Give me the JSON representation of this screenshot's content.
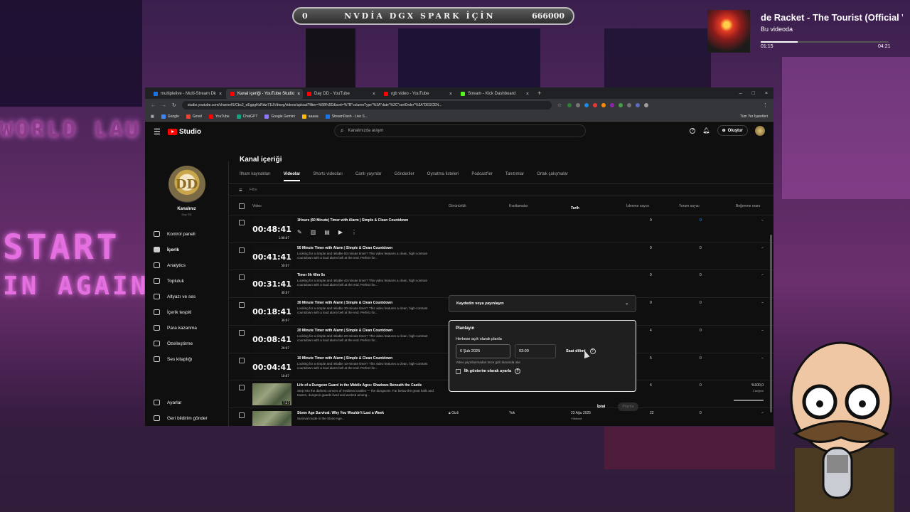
{
  "stream": {
    "goal_left": "0",
    "goal_text": "NVDİA DGX SPARK İÇİN",
    "goal_right": "666000",
    "now_playing_title": "de Racket - The Tourist (Official Vi",
    "now_playing_sub": "Bu videoda",
    "time_elapsed": "01:15",
    "time_total": "04:21",
    "progress": 0.29,
    "neon_sign_1": "WORLD LAU",
    "neon_sign_2": "START",
    "neon_sign_3": "IN AGAIN"
  },
  "browser": {
    "tabs": [
      {
        "label": "multiplelive - Multi-Stream Dk",
        "color": "#1a73e8"
      },
      {
        "label": "Kanal içeriği - YouTube Studio",
        "color": "#ff0000",
        "active": true
      },
      {
        "label": "Day DD - YouTube",
        "color": "#ff0000"
      },
      {
        "label": "rgb video - YouTube",
        "color": "#ff0000"
      },
      {
        "label": "Stream - Kick Dashboard",
        "color": "#53fc18"
      }
    ],
    "url": "studio.youtube.com/channel/UCbc2_eEgpgHzRdw71UVdwvg/videos/upload?filter=%5B%5D&sort=%7B\"columnType\"%3A\"date\"%2C\"sortOrder\"%3A\"DESCEN...",
    "bookmarks": [
      "Google",
      "Gmail",
      "YouTube",
      "ChatGPT",
      "Google Gemini",
      "aaaaa",
      "StreamDash - Live S..."
    ],
    "all_bookmarks": "Tüm Yer İşaretleri"
  },
  "studio": {
    "logo": "Studio",
    "search_placeholder": "Kanalınızda arayın",
    "create_label": "Oluştur",
    "channel_label": "Kanalınız",
    "channel_name": "Day DD",
    "nav": [
      {
        "label": "Kontrol paneli",
        "icon": "dashboard-icon"
      },
      {
        "label": "İçerik",
        "icon": "content-icon",
        "active": true
      },
      {
        "label": "Analytics",
        "icon": "analytics-icon"
      },
      {
        "label": "Topluluk",
        "icon": "community-icon"
      },
      {
        "label": "Altyazı ve ses",
        "icon": "subtitles-icon"
      },
      {
        "label": "İçerik tespiti",
        "icon": "copyright-icon"
      },
      {
        "label": "Para kazanma",
        "icon": "earn-icon"
      },
      {
        "label": "Özelleştirme",
        "icon": "customization-icon"
      },
      {
        "label": "Ses kitaplığı",
        "icon": "audio-library-icon"
      }
    ],
    "settings_label": "Ayarlar",
    "feedback_label": "Geri bildirim gönder",
    "page_title": "Kanal içeriği",
    "content_tabs": [
      "İlham kaynakları",
      "Videolar",
      "Shorts videoları",
      "Canlı yayınlar",
      "Gönderiler",
      "Oynatma listeleri",
      "Podcast'ler",
      "Tanıtımlar",
      "Ortak çalışmalar"
    ],
    "active_tab": "Videolar",
    "filter_placeholder": "Filtre",
    "columns": {
      "video": "Video",
      "visibility": "Görünürlük",
      "restrictions": "Kısıtlamalar",
      "date": "Tarih",
      "views": "İzlenme sayısı",
      "comments": "Yorum sayısı",
      "likes": "Beğenme oranı"
    },
    "videos": [
      {
        "duration": "00:48:41",
        "dur_small": "1:00:07",
        "title": "1Hours (60 Minute) Timer with Alarm | Simple & Clean Countdown",
        "desc": "",
        "views": "0",
        "comments": "0",
        "likes": "–"
      },
      {
        "duration": "00:41:41",
        "dur_small": "50:07",
        "title": "50 Minute Timer with Alarm | Simple & Clean Countdown",
        "desc": "Looking for a simple and reliable 50 minute timer? This video features a clean, high-contrast countdown with a loud alarm bell at the end. Perfect for...",
        "views": "0",
        "comments": "0",
        "likes": "–"
      },
      {
        "duration": "00:31:41",
        "dur_small": "40:07",
        "title": "Timer 0h 40m 0s",
        "desc": "Looking for a simple and reliable 40 minute timer? This video features a clean, high-contrast countdown with a loud alarm bell at the end. Perfect for...",
        "views": "0",
        "comments": "0",
        "likes": "–"
      },
      {
        "duration": "00:18:41",
        "dur_small": "30:07",
        "title": "30 Minute Timer with Alarm | Simple & Clean Countdown",
        "desc": "Looking for a simple and reliable 30-minute timer? This video features a clean, high-contrast countdown with a loud alarm bell at the end. Perfect for...",
        "views": "0",
        "comments": "0",
        "likes": "–"
      },
      {
        "duration": "00:08:41",
        "dur_small": "20:07",
        "title": "20 Minute Timer with Alarm | Simple & Clean Countdown",
        "desc": "Looking for a simple and reliable 20-minute timer? This video features a clean, high-contrast countdown with a loud alarm bell at the end. Perfect for...",
        "views": "4",
        "comments": "0",
        "likes": "–"
      },
      {
        "duration": "00:04:41",
        "dur_small": "10:07",
        "title": "10 Minute Timer with Alarm | Simple & Clean Countdown",
        "desc": "Looking for a simple and reliable 10-minute timer? This video features a clean, high-contrast countdown with a loud alarm bell at the end. Perfect for...",
        "visibility": "Herkese açık",
        "restrictions": "Yok",
        "date": "5 Şub 2026",
        "date_sub": "Yayınlandı",
        "views": "5",
        "comments": "0",
        "likes": "–"
      },
      {
        "duration": "",
        "dur_small": "7:27",
        "title": "Life of a Dungeon Guard in the Middle Ages: Shadows Beneath the Castle",
        "desc": "Step into the darkest corners of medieval castles — the dungeons. Far below the great halls and towers, dungeon guards lived and worked among...",
        "visibility": "Gizli",
        "restrictions": "Yok",
        "date": "24 Ağu 2025",
        "date_sub": "Yüklendi",
        "views": "4",
        "comments": "0",
        "likes": "%100,0",
        "likes_sub": "2 beğeni",
        "likes_progress": 1.0
      },
      {
        "duration": "",
        "dur_small": "",
        "title": "Stone Age Survival: Why You Wouldn't Last a Week",
        "desc": "Survival mode in the Stone Age...",
        "visibility": "Gizli",
        "restrictions": "Yok",
        "date": "23 Ağu 2025",
        "date_sub": "Yüklendi",
        "views": "22",
        "comments": "0",
        "likes": "–"
      }
    ],
    "row_actions": [
      "edit-icon",
      "analytics-icon",
      "comments-icon",
      "youtube-icon",
      "more-icon"
    ],
    "save_dropdown": "Kaydedin veya yayınlayın",
    "schedule": {
      "heading": "Planlayın",
      "subheading": "Herkese açık olarak planla",
      "date": "6 Şub 2026",
      "time": "03:00",
      "timezone": "Saat dilimi",
      "note": "Video yayınlanmadan önce gizli durumda olur",
      "premiere_label": "İlk gösterim olarak ayarla"
    },
    "cancel_label": "İptal",
    "schedule_button": "Planla"
  }
}
